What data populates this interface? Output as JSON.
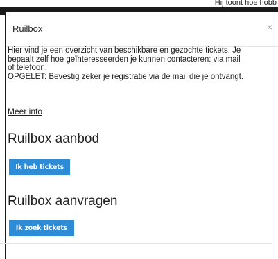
{
  "background": {
    "partial_text": "Hij toont hoe hobb"
  },
  "modal": {
    "title": "Ruilbox",
    "close_label": "×",
    "intro_lines": [
      "Hier vind je een overzicht van beschikbare en gezochte tickets. Je",
      "bepaalt zelf hoe geïnteresseerden je kunnen contacteren: via mail",
      "of telefoon.",
      "OPGELET: Bevestig zeker je registratie via de mail die je ontvangt."
    ],
    "meer_info": "Meer info",
    "aanbod": {
      "title": "Ruilbox aanbod",
      "button": "Ik heb tickets"
    },
    "aanvragen": {
      "title": "Ruilbox aanvragen",
      "button": "Ik zoek tickets"
    }
  },
  "colors": {
    "button_bg": "#2e8bd6",
    "button_text": "#ffffff",
    "backdrop_dark": "#1a1a1a"
  }
}
